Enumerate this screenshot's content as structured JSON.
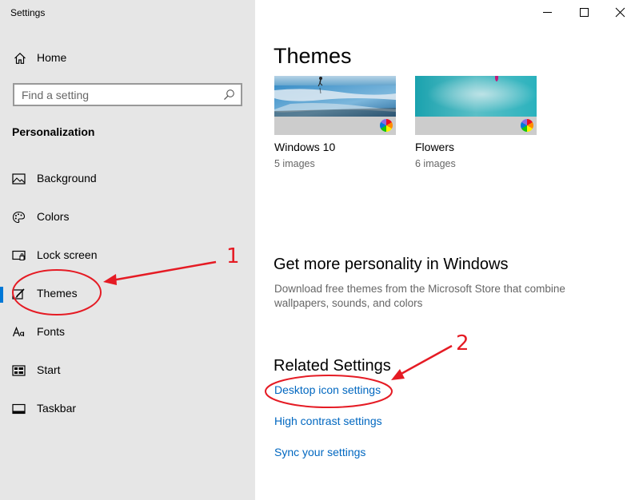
{
  "window": {
    "title": "Settings",
    "controls": [
      "minimize-icon",
      "maximize-icon",
      "close-icon"
    ]
  },
  "sidebar": {
    "home": {
      "label": "Home",
      "icon": "home-icon"
    },
    "search": {
      "placeholder": "Find a setting",
      "icon": "search-icon"
    },
    "section_title": "Personalization",
    "items": [
      {
        "label": "Background",
        "icon": "picture-icon",
        "active": false
      },
      {
        "label": "Colors",
        "icon": "palette-icon",
        "active": false
      },
      {
        "label": "Lock screen",
        "icon": "lock-screen-icon",
        "active": false
      },
      {
        "label": "Themes",
        "icon": "paintbrush-icon",
        "active": true
      },
      {
        "label": "Fonts",
        "icon": "fonts-icon",
        "active": false
      },
      {
        "label": "Start",
        "icon": "start-icon",
        "active": false
      },
      {
        "label": "Taskbar",
        "icon": "taskbar-icon",
        "active": false
      }
    ],
    "accent_color": "#0078d7"
  },
  "main": {
    "title": "Themes",
    "themes": [
      {
        "name": "Windows 10",
        "count": "5 images"
      },
      {
        "name": "Flowers",
        "count": "6 images"
      }
    ],
    "more_heading": "Get more personality in Windows",
    "more_desc": "Download free themes from the Microsoft Store that combine wallpapers, sounds, and colors",
    "related_heading": "Related Settings",
    "links": [
      "Desktop icon settings",
      "High contrast settings",
      "Sync your settings"
    ],
    "link_color": "#0067c0"
  },
  "annotations": {
    "color": "#e51b24",
    "labels": [
      "1",
      "2"
    ]
  }
}
